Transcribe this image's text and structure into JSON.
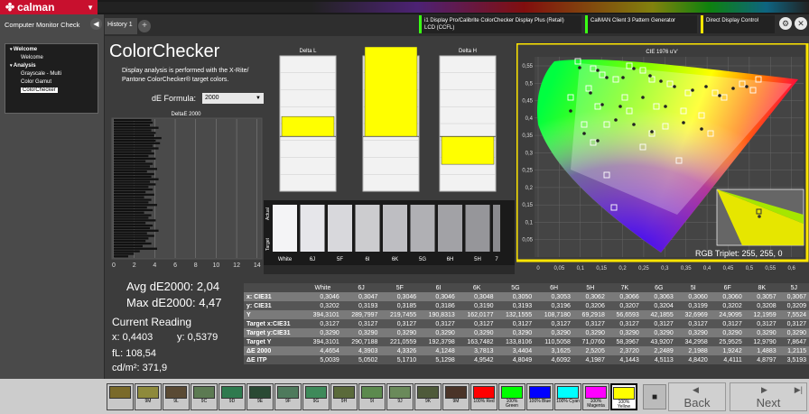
{
  "app": {
    "logo": "calman",
    "tab": "History 1",
    "tab_add": "+"
  },
  "devices": [
    {
      "line1": "i1 Display Pro/Calibrite ColorChecker Display Plus (Retail)",
      "line2": "LCD (CCFL)"
    },
    {
      "line1": "CalMAN Client 3 Pattern Generator",
      "line2": ""
    },
    {
      "line1": "Direct Display Control",
      "line2": ""
    }
  ],
  "window": {
    "settings": "⚙",
    "close": "✕"
  },
  "sidebar": {
    "title": "Computer Monitor Check",
    "tree": [
      {
        "label": "Welcome",
        "level": 0,
        "bold": true
      },
      {
        "label": "Welcome",
        "level": 1
      },
      {
        "label": "Analysis",
        "level": 0,
        "bold": true
      },
      {
        "label": "Grayscale - Multi",
        "level": 1
      },
      {
        "label": "Color Gamut",
        "level": 1
      },
      {
        "label": "ColorChecker",
        "level": 1,
        "selected": true
      }
    ]
  },
  "page": {
    "title": "ColorChecker",
    "description": "Display analysis is performed with the X-Rite/ Pantone ColorChecker® target colors.",
    "formula_label": "dE Formula:",
    "formula_value": "2000"
  },
  "hist": {
    "title": "DeltaE 2000",
    "ticks": [
      "0",
      "2",
      "4",
      "6",
      "8",
      "10",
      "12",
      "14"
    ]
  },
  "deltas": [
    {
      "title": "Delta L",
      "value": 1
    },
    {
      "title": "Delta C",
      "value": 4.5
    },
    {
      "title": "Delta H",
      "value": -1.4
    }
  ],
  "swatches": {
    "actual_label": "Actual",
    "target_label": "Target",
    "names": [
      "White",
      "6J",
      "5F",
      "6I",
      "6K",
      "5G",
      "6H",
      "5H",
      "7"
    ],
    "shades": [
      "#f4f4f6",
      "#e6e6ea",
      "#d8d8dc",
      "#cccccf",
      "#bebec2",
      "#b0b0b4",
      "#a2a2a6",
      "#96969a",
      "#8a8a8e"
    ]
  },
  "cie": {
    "title": "CIE 1976 u'v'",
    "rgb_triplet": "RGB Triplet: 255, 255, 0",
    "xticks": [
      "0",
      "0,05",
      "0,1",
      "0,15",
      "0,2",
      "0,25",
      "0,3",
      "0,35",
      "0,4",
      "0,45",
      "0,5",
      "0,55",
      "0,6"
    ],
    "yticks": [
      "0,55",
      "0,5",
      "0,45",
      "0,4",
      "0,35",
      "0,3",
      "0,25",
      "0,2",
      "0,15",
      "0,1",
      "0,05"
    ]
  },
  "stats": {
    "avg": "Avg dE2000: 2,04",
    "max": "Max dE2000: 4,47",
    "current_reading": "Current Reading",
    "x": "x: 0,4403",
    "y": "y: 0,5379",
    "fl": "fL: 108,54",
    "cdm2": "cd/m²: 371,9"
  },
  "table": {
    "headers": [
      "",
      "White",
      "6J",
      "5F",
      "6I",
      "6K",
      "5G",
      "6H",
      "5H",
      "7K",
      "6G",
      "5I",
      "6F",
      "8K",
      "5J"
    ],
    "rows": [
      [
        "x: CIE31",
        "0,3046",
        "0,3047",
        "0,3046",
        "0,3046",
        "0,3048",
        "0,3050",
        "0,3053",
        "0,3062",
        "0,3066",
        "0,3063",
        "0,3060",
        "0,3060",
        "0,3057",
        "0,3067"
      ],
      [
        "y: CIE31",
        "0,3202",
        "0,3193",
        "0,3185",
        "0,3186",
        "0,3190",
        "0,3193",
        "0,3196",
        "0,3206",
        "0,3207",
        "0,3204",
        "0,3199",
        "0,3202",
        "0,3208",
        "0,3209"
      ],
      [
        "Y",
        "394,3101",
        "289,7997",
        "219,7455",
        "190,8313",
        "162,0177",
        "132,1555",
        "108,7180",
        "69,2918",
        "56,6593",
        "42,1855",
        "32,6969",
        "24,9095",
        "12,1959",
        "7,5524"
      ],
      [
        "Target x:CIE31",
        "0,3127",
        "0,3127",
        "0,3127",
        "0,3127",
        "0,3127",
        "0,3127",
        "0,3127",
        "0,3127",
        "0,3127",
        "0,3127",
        "0,3127",
        "0,3127",
        "0,3127",
        "0,3127"
      ],
      [
        "Target y:CIE31",
        "0,3290",
        "0,3290",
        "0,3290",
        "0,3290",
        "0,3290",
        "0,3290",
        "0,3290",
        "0,3290",
        "0,3290",
        "0,3290",
        "0,3290",
        "0,3290",
        "0,3290",
        "0,3290"
      ],
      [
        "Target Y",
        "394,3101",
        "290,7188",
        "221,0559",
        "192,3798",
        "163,7482",
        "133,8106",
        "110,5058",
        "71,0760",
        "58,3967",
        "43,9207",
        "34,2958",
        "25,9525",
        "12,9790",
        "7,8647"
      ],
      [
        "ΔE 2000",
        "4,4654",
        "4,3903",
        "4,3326",
        "4,1248",
        "3,7813",
        "3,4404",
        "3,1625",
        "2,5205",
        "2,3720",
        "2,2489",
        "2,1988",
        "1,9242",
        "1,4883",
        "1,2115"
      ],
      [
        "ΔE ITP",
        "5,0039",
        "5,0502",
        "5,1710",
        "5,1298",
        "4,9542",
        "4,8049",
        "4,6092",
        "4,1987",
        "4,1443",
        "4,5113",
        "4,8420",
        "4,4111",
        "4,8797",
        "3,5193"
      ]
    ]
  },
  "patches": [
    {
      "label": "",
      "color": "#7a6a2a"
    },
    {
      "label": "9M",
      "color": "#8e8a3c"
    },
    {
      "label": "9L",
      "color": "#5a4a34"
    },
    {
      "label": "9C",
      "color": "#5c7a52"
    },
    {
      "label": "9D",
      "color": "#2e7a4e"
    },
    {
      "label": "9E",
      "color": "#2a4a34"
    },
    {
      "label": "9F",
      "color": "#4e7a5c"
    },
    {
      "label": "9G",
      "color": "#3e8a5a"
    },
    {
      "label": "9H",
      "color": "#5a6a3a"
    },
    {
      "label": "9I",
      "color": "#5c8a4e"
    },
    {
      "label": "9J",
      "color": "#6a8a5a"
    },
    {
      "label": "9K",
      "color": "#4e5a3a"
    },
    {
      "label": "9M",
      "color": "#4a3428"
    },
    {
      "label": "100% Red",
      "color": "#ff0000"
    },
    {
      "label": "100% Green",
      "color": "#00ff00"
    },
    {
      "label": "100% Blue",
      "color": "#0000ff"
    },
    {
      "label": "100% Cyan",
      "color": "#00ffff"
    },
    {
      "label": "100% Magenta",
      "color": "#ff00ff"
    },
    {
      "label": "100% Yellow",
      "color": "#ffff00"
    }
  ],
  "nav": {
    "back": "Back",
    "next": "Next"
  }
}
